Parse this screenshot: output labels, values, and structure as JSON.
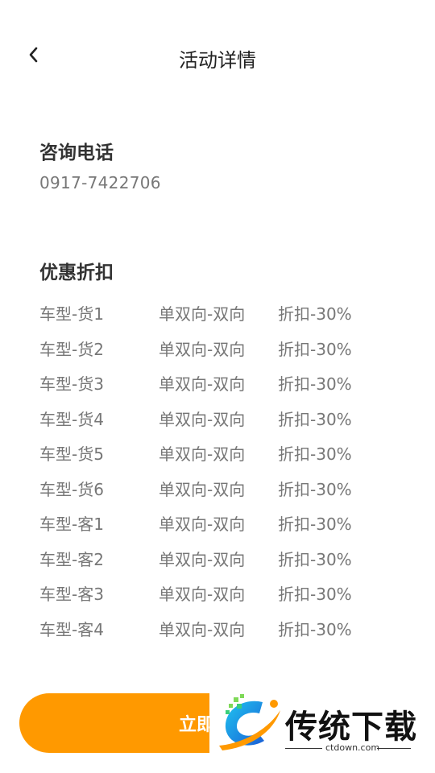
{
  "header": {
    "title": "活动详情",
    "back_icon": "chevron-left-icon"
  },
  "phone_section": {
    "title": "咨询电话",
    "value": "0917-7422706"
  },
  "discount_section": {
    "title": "优惠折扣",
    "rows": [
      {
        "type": "车型-货1",
        "direction": "单双向-双向",
        "discount": "折扣-30%"
      },
      {
        "type": "车型-货2",
        "direction": "单双向-双向",
        "discount": "折扣-30%"
      },
      {
        "type": "车型-货3",
        "direction": "单双向-双向",
        "discount": "折扣-30%"
      },
      {
        "type": "车型-货4",
        "direction": "单双向-双向",
        "discount": "折扣-30%"
      },
      {
        "type": "车型-货5",
        "direction": "单双向-双向",
        "discount": "折扣-30%"
      },
      {
        "type": "车型-货6",
        "direction": "单双向-双向",
        "discount": "折扣-30%"
      },
      {
        "type": "车型-客1",
        "direction": "单双向-双向",
        "discount": "折扣-30%"
      },
      {
        "type": "车型-客2",
        "direction": "单双向-双向",
        "discount": "折扣-30%"
      },
      {
        "type": "车型-客3",
        "direction": "单双向-双向",
        "discount": "折扣-30%"
      },
      {
        "type": "车型-客4",
        "direction": "单双向-双向",
        "discount": "折扣-30%"
      }
    ]
  },
  "action_button": {
    "label": "立即",
    "color": "#ff9900"
  },
  "watermark": {
    "text": "传统下载",
    "url": "ctdown.com"
  }
}
